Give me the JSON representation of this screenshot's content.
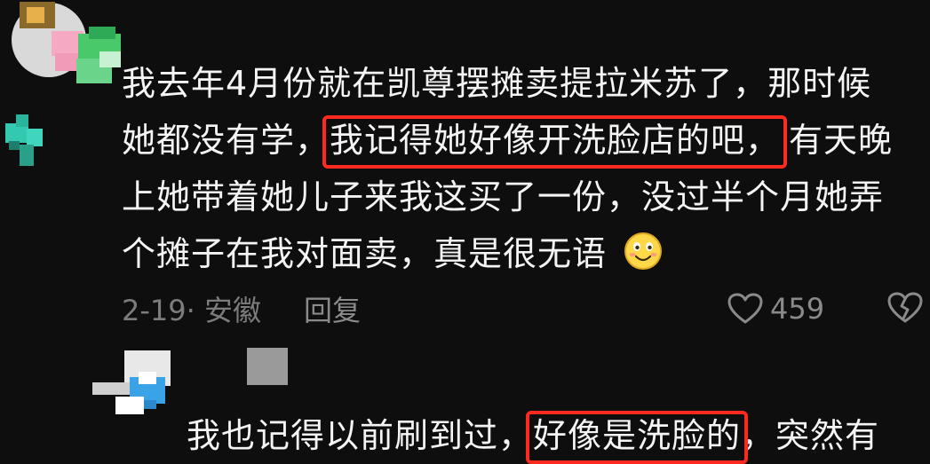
{
  "comment": {
    "lines": [
      {
        "pre": "我去年4月份就在凯尊摆摊卖提拉米苏了，那时候",
        "hl": "",
        "post": ""
      },
      {
        "pre": "她都没有学，",
        "hl": "我记得她好像开洗脸店的吧，",
        "post": "有天晚"
      },
      {
        "pre": "上她带着她儿子来我这买了一份，没过半个月她弄",
        "hl": "",
        "post": ""
      },
      {
        "pre": "个摊子在我对面卖，真是很无语",
        "hl": "",
        "post": ""
      }
    ],
    "emoji_icon": "smiling-face-icon",
    "date_location": "2-19· 安徽",
    "reply_label": "回复",
    "like_count": "459"
  },
  "reply_comment": {
    "pre": "我也记得以前刷到过，",
    "hl": "好像是洗脸的",
    "post": "，突然有"
  },
  "colors": {
    "background": "#0e0e0e",
    "text": "#f4f4f4",
    "meta": "#7c7c7c",
    "highlight_box": "#ff2a1f"
  }
}
